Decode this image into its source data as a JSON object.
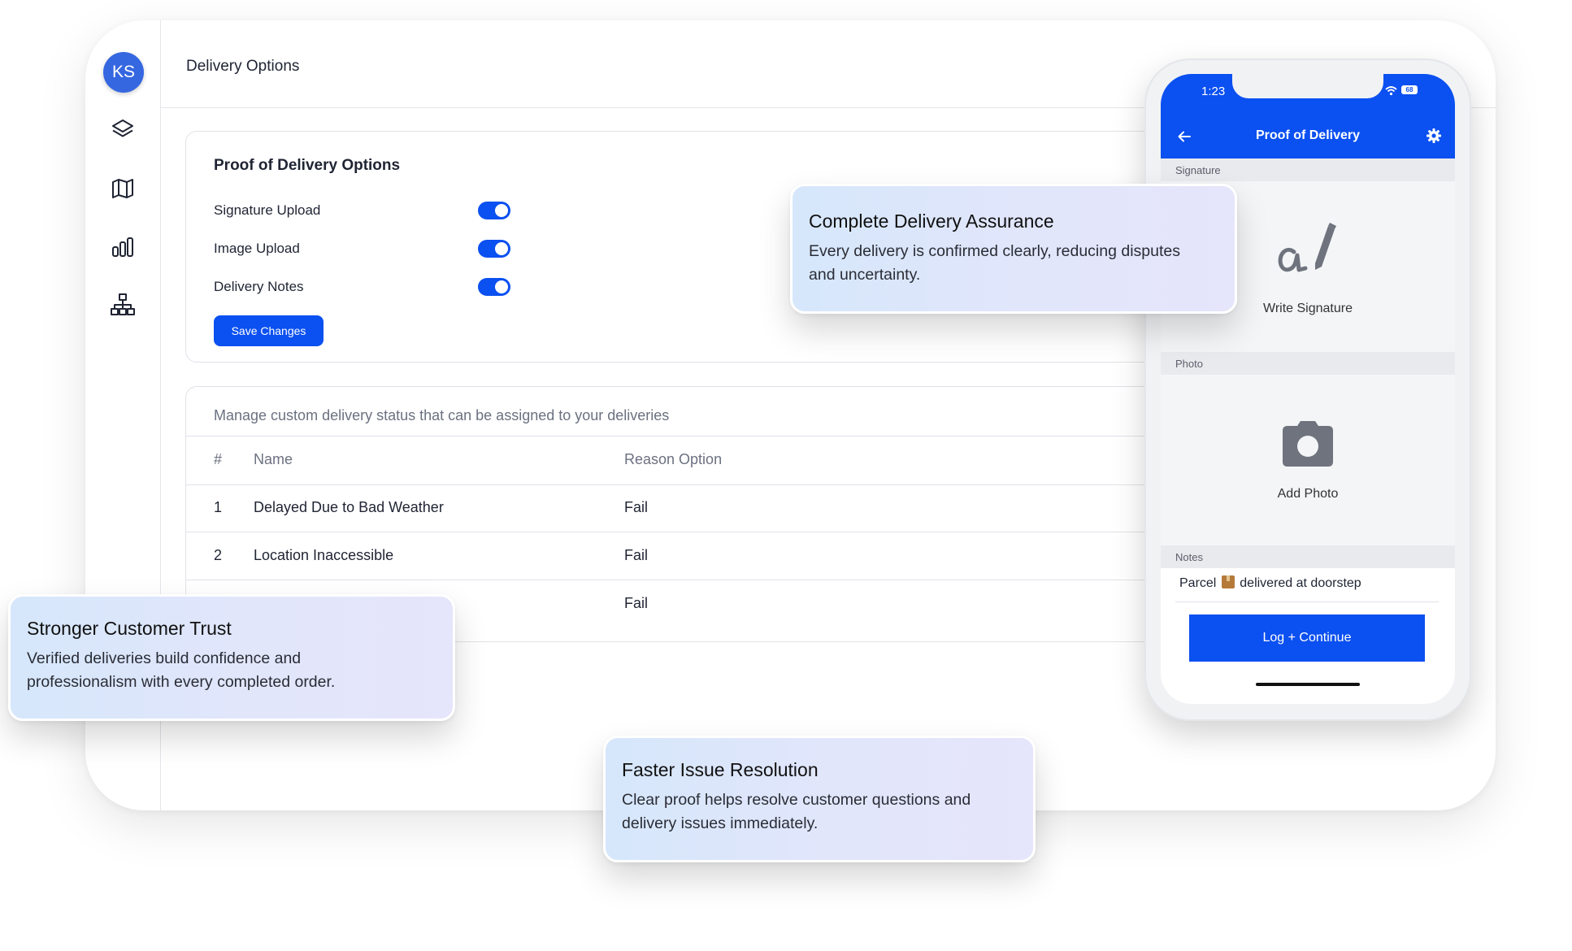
{
  "sidebar": {
    "avatar_initials": "KS",
    "nav": [
      "layers-icon",
      "map-icon",
      "bar-chart-icon",
      "hierarchy-icon"
    ]
  },
  "header": {
    "title": "Delivery Options"
  },
  "pod_options": {
    "title": "Proof of Delivery Options",
    "options": [
      {
        "label": "Signature Upload",
        "enabled": true
      },
      {
        "label": "Image Upload",
        "enabled": true
      },
      {
        "label": "Delivery Notes",
        "enabled": true
      }
    ],
    "save_label": "Save Changes"
  },
  "status_table": {
    "description": "Manage custom delivery status that can be assigned to your deliveries",
    "columns": [
      "#",
      "Name",
      "Reason Option"
    ],
    "rows": [
      {
        "num": "1",
        "name": "Delayed Due to Bad Weather",
        "reason": "Fail"
      },
      {
        "num": "2",
        "name": "Location Inaccessible",
        "reason": "Fail"
      },
      {
        "num": "",
        "name": "",
        "reason": "Fail"
      }
    ]
  },
  "phone": {
    "time": "1:23",
    "battery": "68",
    "title": "Proof of Delivery",
    "signature_section": "Signature",
    "signature_label": "Write Signature",
    "photo_section": "Photo",
    "photo_label": "Add Photo",
    "notes_section": "Notes",
    "notes_before": "Parcel",
    "notes_after": "delivered at doorstep",
    "log_button": "Log + Continue"
  },
  "callouts": [
    {
      "title": "Complete Delivery Assurance",
      "text": "Every delivery is confirmed clearly, reducing disputes and uncertainty."
    },
    {
      "title": "Stronger Customer Trust",
      "text": "Verified deliveries build confidence and professionalism with every completed order."
    },
    {
      "title": "Faster Issue Resolution",
      "text": "Clear proof helps resolve customer questions and delivery issues immediately."
    }
  ],
  "colors": {
    "primary": "#0b50f0",
    "avatar": "#3567e0",
    "border": "#dfe2e8",
    "callout_bg": "#dfe7fb"
  }
}
